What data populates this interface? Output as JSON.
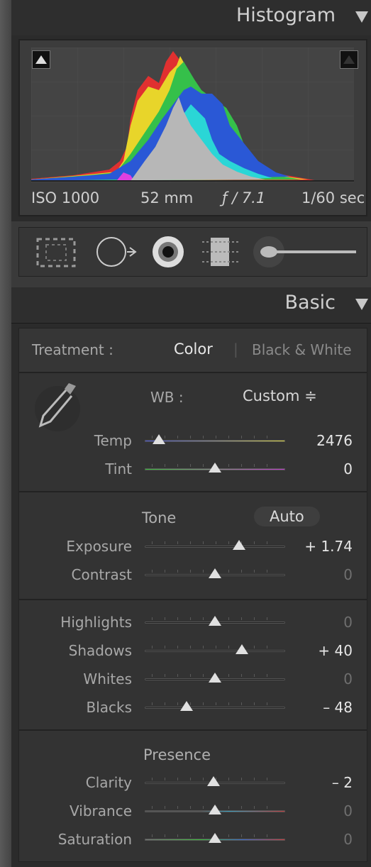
{
  "histogram": {
    "title": "Histogram",
    "iso": "ISO 1000",
    "focal": "52 mm",
    "aperture": "ƒ / 7.1",
    "shutter": "1/60 sec"
  },
  "basic": {
    "title": "Basic",
    "treatment_label": "Treatment :",
    "treatment_color": "Color",
    "treatment_bw": "Black & White",
    "wb_label": "WB :",
    "wb_value": "Custom ≑",
    "tone_label": "Tone",
    "auto_label": "Auto",
    "presence_label": "Presence"
  },
  "sliders": [
    {
      "name": "Temp",
      "value": "2476",
      "position": 0.1
    },
    {
      "name": "Tint",
      "value": "0",
      "position": 0.5
    },
    {
      "name": "Exposure",
      "value": "+ 1.74",
      "position": 0.67
    },
    {
      "name": "Contrast",
      "value": "0",
      "position": 0.5
    },
    {
      "name": "Highlights",
      "value": "0",
      "position": 0.5
    },
    {
      "name": "Shadows",
      "value": "+ 40",
      "position": 0.69
    },
    {
      "name": "Whites",
      "value": "0",
      "position": 0.5
    },
    {
      "name": "Blacks",
      "value": "– 48",
      "position": 0.3
    },
    {
      "name": "Clarity",
      "value": "– 2",
      "position": 0.49
    },
    {
      "name": "Vibrance",
      "value": "0",
      "position": 0.5
    },
    {
      "name": "Saturation",
      "value": "0",
      "position": 0.5
    }
  ],
  "icons": [
    "crop-icon",
    "spot-removal-icon",
    "red-eye-icon",
    "graduated-filter-icon",
    "adjustment-brush-icon"
  ]
}
